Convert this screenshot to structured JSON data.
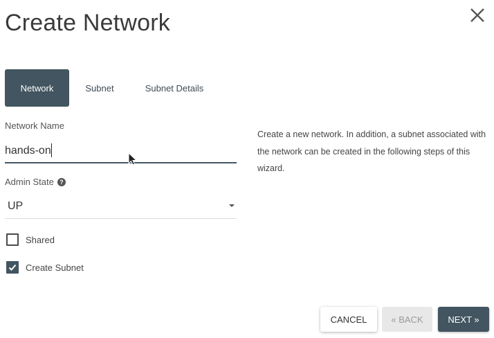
{
  "dialog": {
    "title": "Create Network",
    "close_icon": "close-icon"
  },
  "tabs": [
    {
      "label": "Network",
      "active": true
    },
    {
      "label": "Subnet",
      "active": false
    },
    {
      "label": "Subnet Details",
      "active": false
    }
  ],
  "form": {
    "network_name_label": "Network Name",
    "network_name_value": "hands-on",
    "admin_state_label": "Admin State",
    "admin_state_help_icon": "help-icon",
    "admin_state_value": "UP",
    "shared_label": "Shared",
    "shared_checked": false,
    "create_subnet_label": "Create Subnet",
    "create_subnet_checked": true
  },
  "description": "Create a new network. In addition, a subnet associated with the network can be created in the following steps of this wizard.",
  "buttons": {
    "cancel": "CANCEL",
    "back": "« BACK",
    "next": "NEXT »"
  },
  "colors": {
    "accent": "#425560",
    "disabled_bg": "#e8e8e8",
    "disabled_text": "#999999"
  }
}
